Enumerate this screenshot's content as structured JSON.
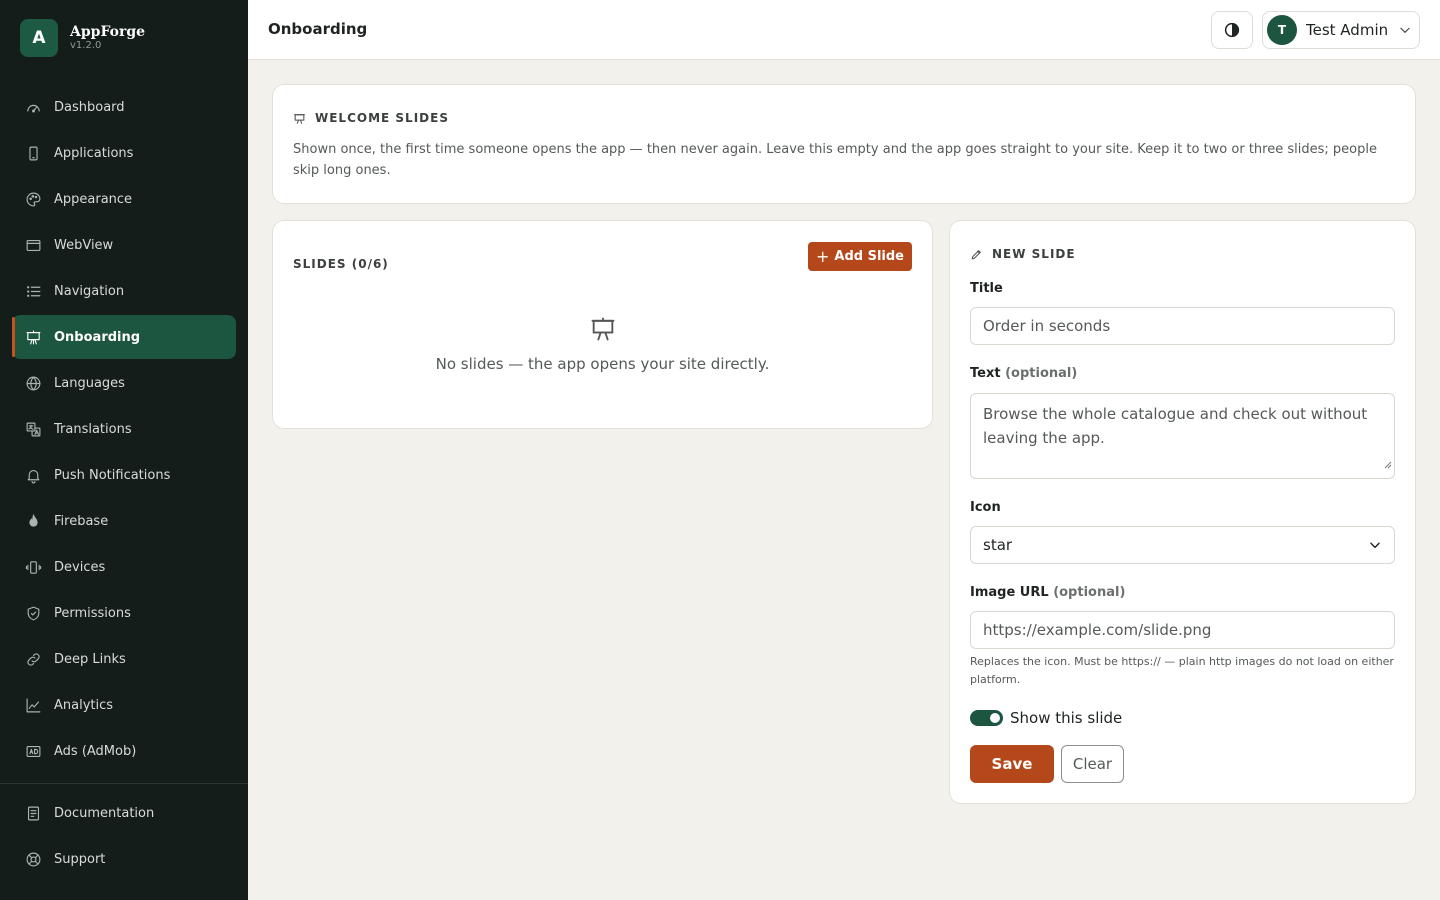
{
  "brand": {
    "logo_letter": "A",
    "name": "AppForge",
    "version": "v1.2.0"
  },
  "sidebar": {
    "items": [
      {
        "label": "Dashboard",
        "icon": "gauge-icon"
      },
      {
        "label": "Applications",
        "icon": "phone-icon"
      },
      {
        "label": "Appearance",
        "icon": "palette-icon"
      },
      {
        "label": "WebView",
        "icon": "browser-window-icon"
      },
      {
        "label": "Navigation",
        "icon": "list-icon"
      },
      {
        "label": "Onboarding",
        "icon": "presentation-icon",
        "active": true
      },
      {
        "label": "Languages",
        "icon": "globe-icon"
      },
      {
        "label": "Translations",
        "icon": "translate-icon"
      },
      {
        "label": "Push Notifications",
        "icon": "bell-icon"
      },
      {
        "label": "Firebase",
        "icon": "flame-icon"
      },
      {
        "label": "Devices",
        "icon": "vibrating-phone-icon"
      },
      {
        "label": "Permissions",
        "icon": "shield-check-icon"
      },
      {
        "label": "Deep Links",
        "icon": "link-icon"
      },
      {
        "label": "Analytics",
        "icon": "line-chart-icon"
      },
      {
        "label": "Ads (AdMob)",
        "icon": "ad-icon"
      }
    ],
    "bottom_items": [
      {
        "label": "Documentation",
        "icon": "document-icon"
      },
      {
        "label": "Support",
        "icon": "lifebuoy-icon"
      }
    ]
  },
  "header": {
    "title": "Onboarding",
    "theme_toggle_icon": "contrast-icon",
    "user": {
      "initial": "T",
      "name": "Test Admin"
    }
  },
  "welcome": {
    "heading": "WELCOME SLIDES",
    "description": "Shown once, the first time someone opens the app — then never again. Leave this empty and the app goes straight to your site. Keep it to two or three slides; people skip long ones."
  },
  "slides": {
    "title": "SLIDES (0/6)",
    "add_button": "Add Slide",
    "empty_text": "No slides — the app opens your site directly."
  },
  "new_slide": {
    "heading": "NEW SLIDE",
    "title_label": "Title",
    "title_placeholder": "Order in seconds",
    "text_label": "Text",
    "text_optional": "(optional)",
    "text_placeholder": "Browse the whole catalogue and check out without leaving the app.",
    "icon_label": "Icon",
    "icon_value": "star",
    "image_label": "Image URL",
    "image_optional": "(optional)",
    "image_placeholder": "https://example.com/slide.png",
    "image_hint": "Replaces the icon. Must be https:// — plain http images do not load on either platform.",
    "show_toggle_label": "Show this slide",
    "show_toggle_on": true,
    "save_button": "Save",
    "clear_button": "Clear"
  },
  "colors": {
    "sidebar_bg": "#151d1a",
    "active_green": "#1c5540",
    "accent_orange": "#b5481a",
    "page_bg": "#f2f1ec"
  }
}
